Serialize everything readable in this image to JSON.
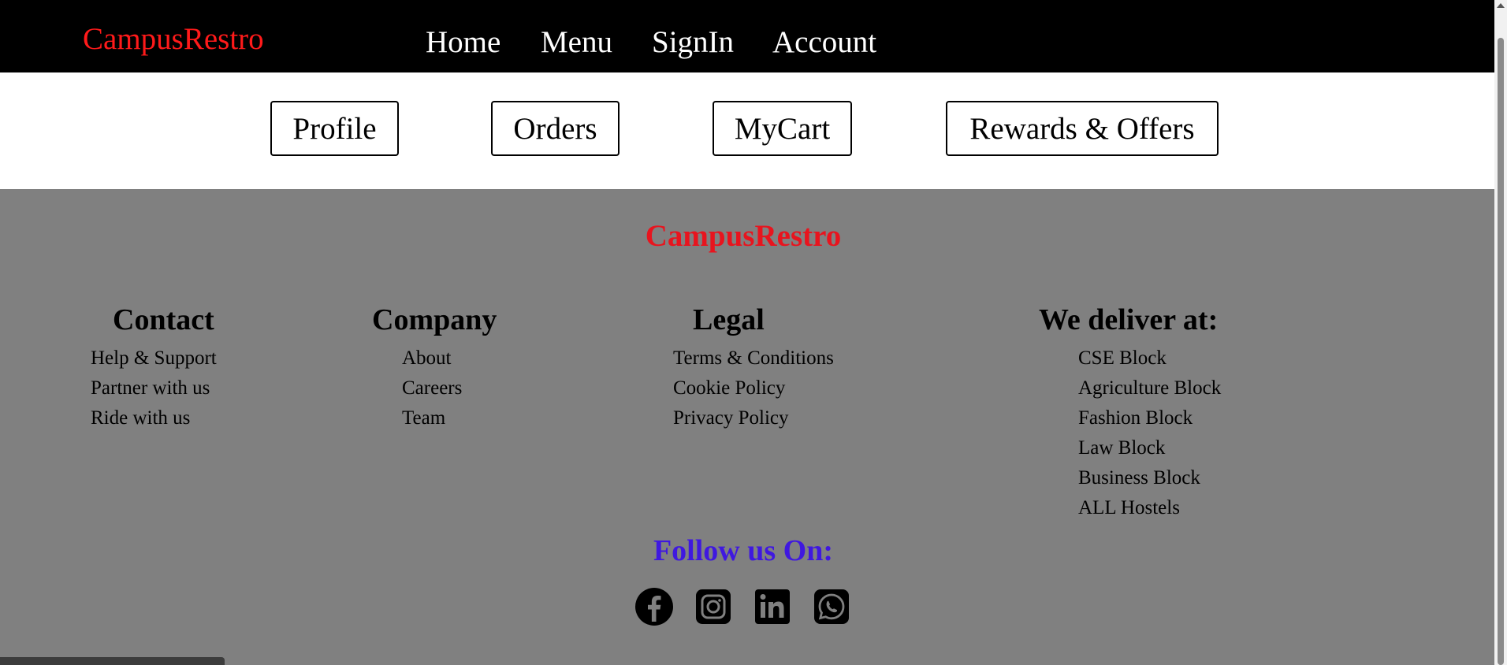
{
  "header": {
    "brand": "CampusRestro",
    "nav": [
      "Home",
      "Menu",
      "SignIn",
      "Account"
    ]
  },
  "account_nav": {
    "buttons": [
      "Profile",
      "Orders",
      "MyCart",
      "Rewards & Offers"
    ]
  },
  "footer": {
    "brand": "CampusRestro",
    "columns": [
      {
        "title": "Contact",
        "links": [
          "Help & Support",
          "Partner with us",
          "Ride with us"
        ]
      },
      {
        "title": "Company",
        "links": [
          "About",
          "Careers",
          "Team"
        ]
      },
      {
        "title": "Legal",
        "links": [
          "Terms & Conditions",
          "Cookie Policy",
          "Privacy Policy"
        ]
      },
      {
        "title": "We deliver at:",
        "links": [
          "CSE Block",
          "Agriculture Block",
          "Fashion Block",
          "Law Block",
          "Business Block",
          "ALL Hostels"
        ]
      }
    ],
    "follow_title": "Follow us On:",
    "social_icons": [
      "facebook-icon",
      "instagram-icon",
      "linkedin-icon",
      "whatsapp-icon"
    ]
  },
  "colors": {
    "brand": "#ff1a1a",
    "follow": "#3f18e0",
    "footer_bg": "#808080",
    "nav_bg": "#000000"
  }
}
